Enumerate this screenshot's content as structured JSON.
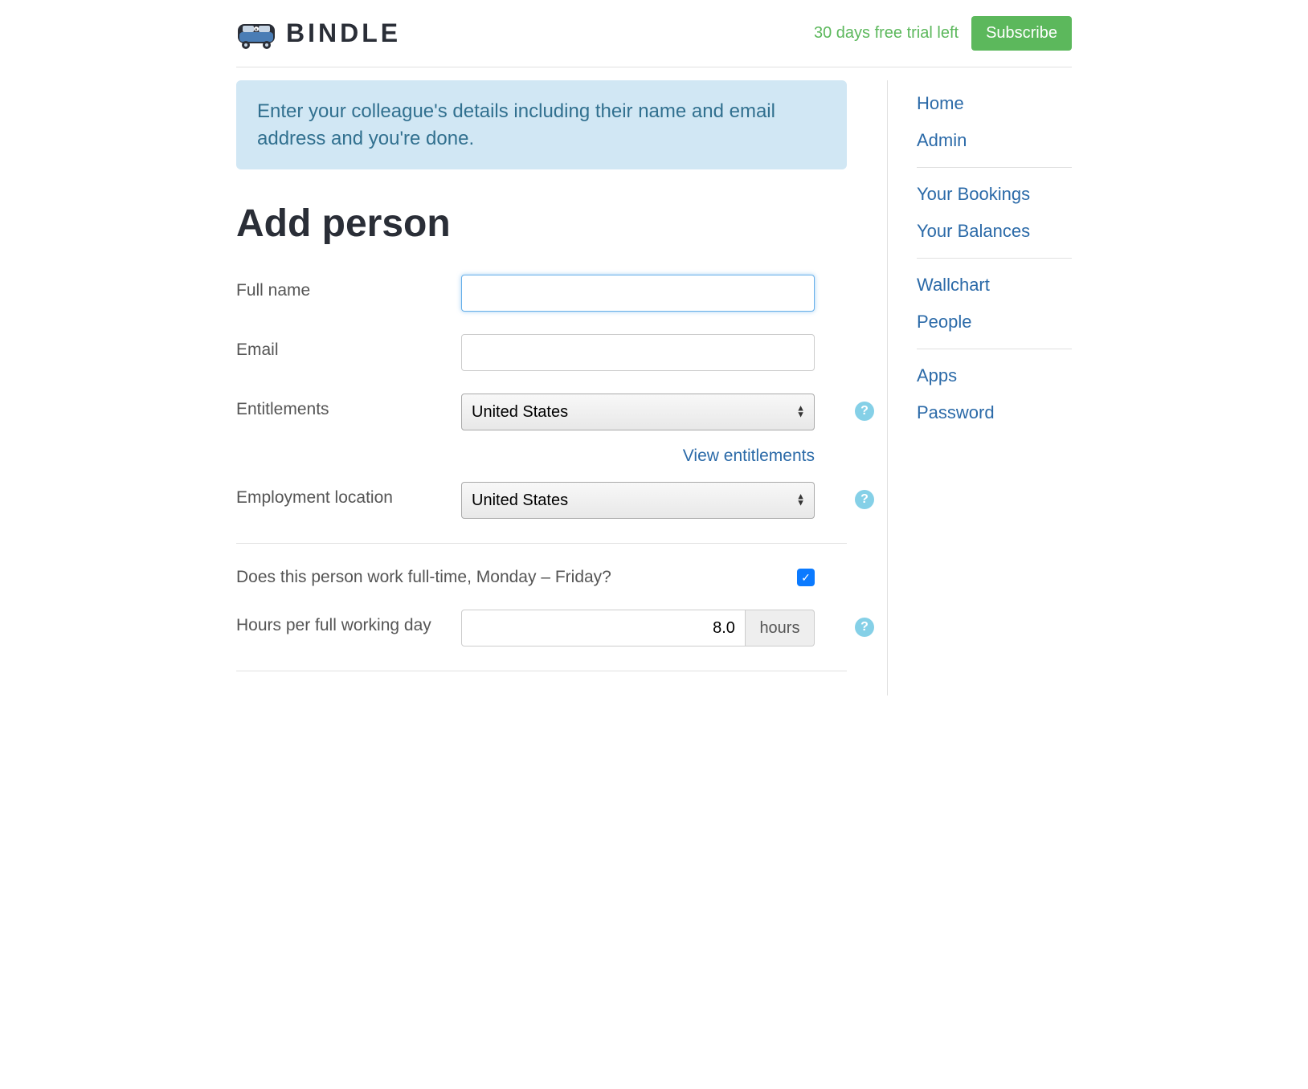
{
  "header": {
    "brand": "BINDLE",
    "trial_text": "30 days free trial left",
    "subscribe_label": "Subscribe"
  },
  "alert": {
    "text": "Enter your colleague's details including their name and email address and you're done."
  },
  "page_title": "Add person",
  "form": {
    "full_name": {
      "label": "Full name",
      "value": ""
    },
    "email": {
      "label": "Email",
      "value": ""
    },
    "entitlements": {
      "label": "Entitlements",
      "selected": "United States",
      "view_link": "View entitlements"
    },
    "employment_location": {
      "label": "Employment location",
      "selected": "United States"
    },
    "fulltime_question": "Does this person work full-time, Monday – Friday?",
    "fulltime_checked": true,
    "hours_per_day": {
      "label": "Hours per full working day",
      "value": "8.0",
      "unit": "hours"
    }
  },
  "sidebar": {
    "groups": [
      {
        "items": [
          "Home",
          "Admin"
        ]
      },
      {
        "items": [
          "Your Bookings",
          "Your Balances"
        ]
      },
      {
        "items": [
          "Wallchart",
          "People"
        ]
      },
      {
        "items": [
          "Apps",
          "Password"
        ]
      }
    ]
  }
}
